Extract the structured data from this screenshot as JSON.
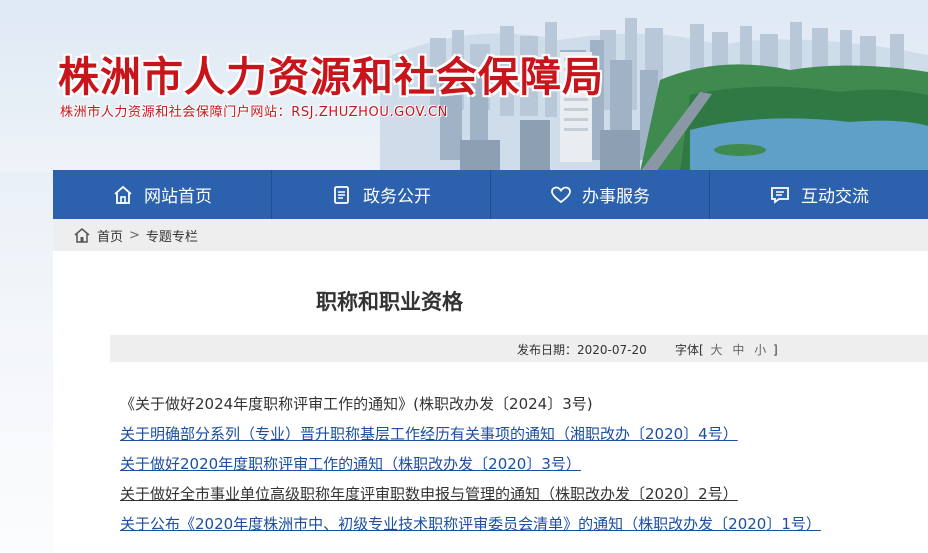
{
  "header": {
    "site_title": "株洲市人力资源和社会保障局",
    "site_subtitle": "株洲市人力资源和社会保障门户网站：RSJ.ZHUZHOU.GOV.CN"
  },
  "nav": [
    {
      "label": "网站首页",
      "icon": "home-icon"
    },
    {
      "label": "政务公开",
      "icon": "document-icon"
    },
    {
      "label": "办事服务",
      "icon": "heart-icon"
    },
    {
      "label": "互动交流",
      "icon": "chat-icon"
    }
  ],
  "breadcrumb": {
    "home": "首页",
    "separator": ">",
    "current": "专题专栏"
  },
  "article": {
    "title": "职称和职业资格",
    "publish_date": "发布日期：2020-07-20",
    "font_size_label": "字体[",
    "font_size_options": [
      "大",
      "中",
      "小"
    ],
    "font_size_close": "]"
  },
  "items": [
    "《关于做好2024年度职称评审工作的通知》(株职改办发〔2024〕3号)",
    "关于明确部分系列（专业）晋升职称基层工作经历有关事项的通知（湘职改办〔2020〕4号）",
    "关于做好2020年度职称评审工作的通知（株职改办发〔2020〕3号）",
    "关于做好全市事业单位高级职称年度评审职数申报与管理的通知（株职改办发〔2020〕2号）",
    "关于公布《2020年度株洲市中、初级专业技术职称评审委员会清单》的通知（株职改办发〔2020〕1号）"
  ],
  "colors": {
    "nav_bg": "#2c62ad",
    "title_red": "#c8141b",
    "link_blue": "#1c4fa0"
  }
}
